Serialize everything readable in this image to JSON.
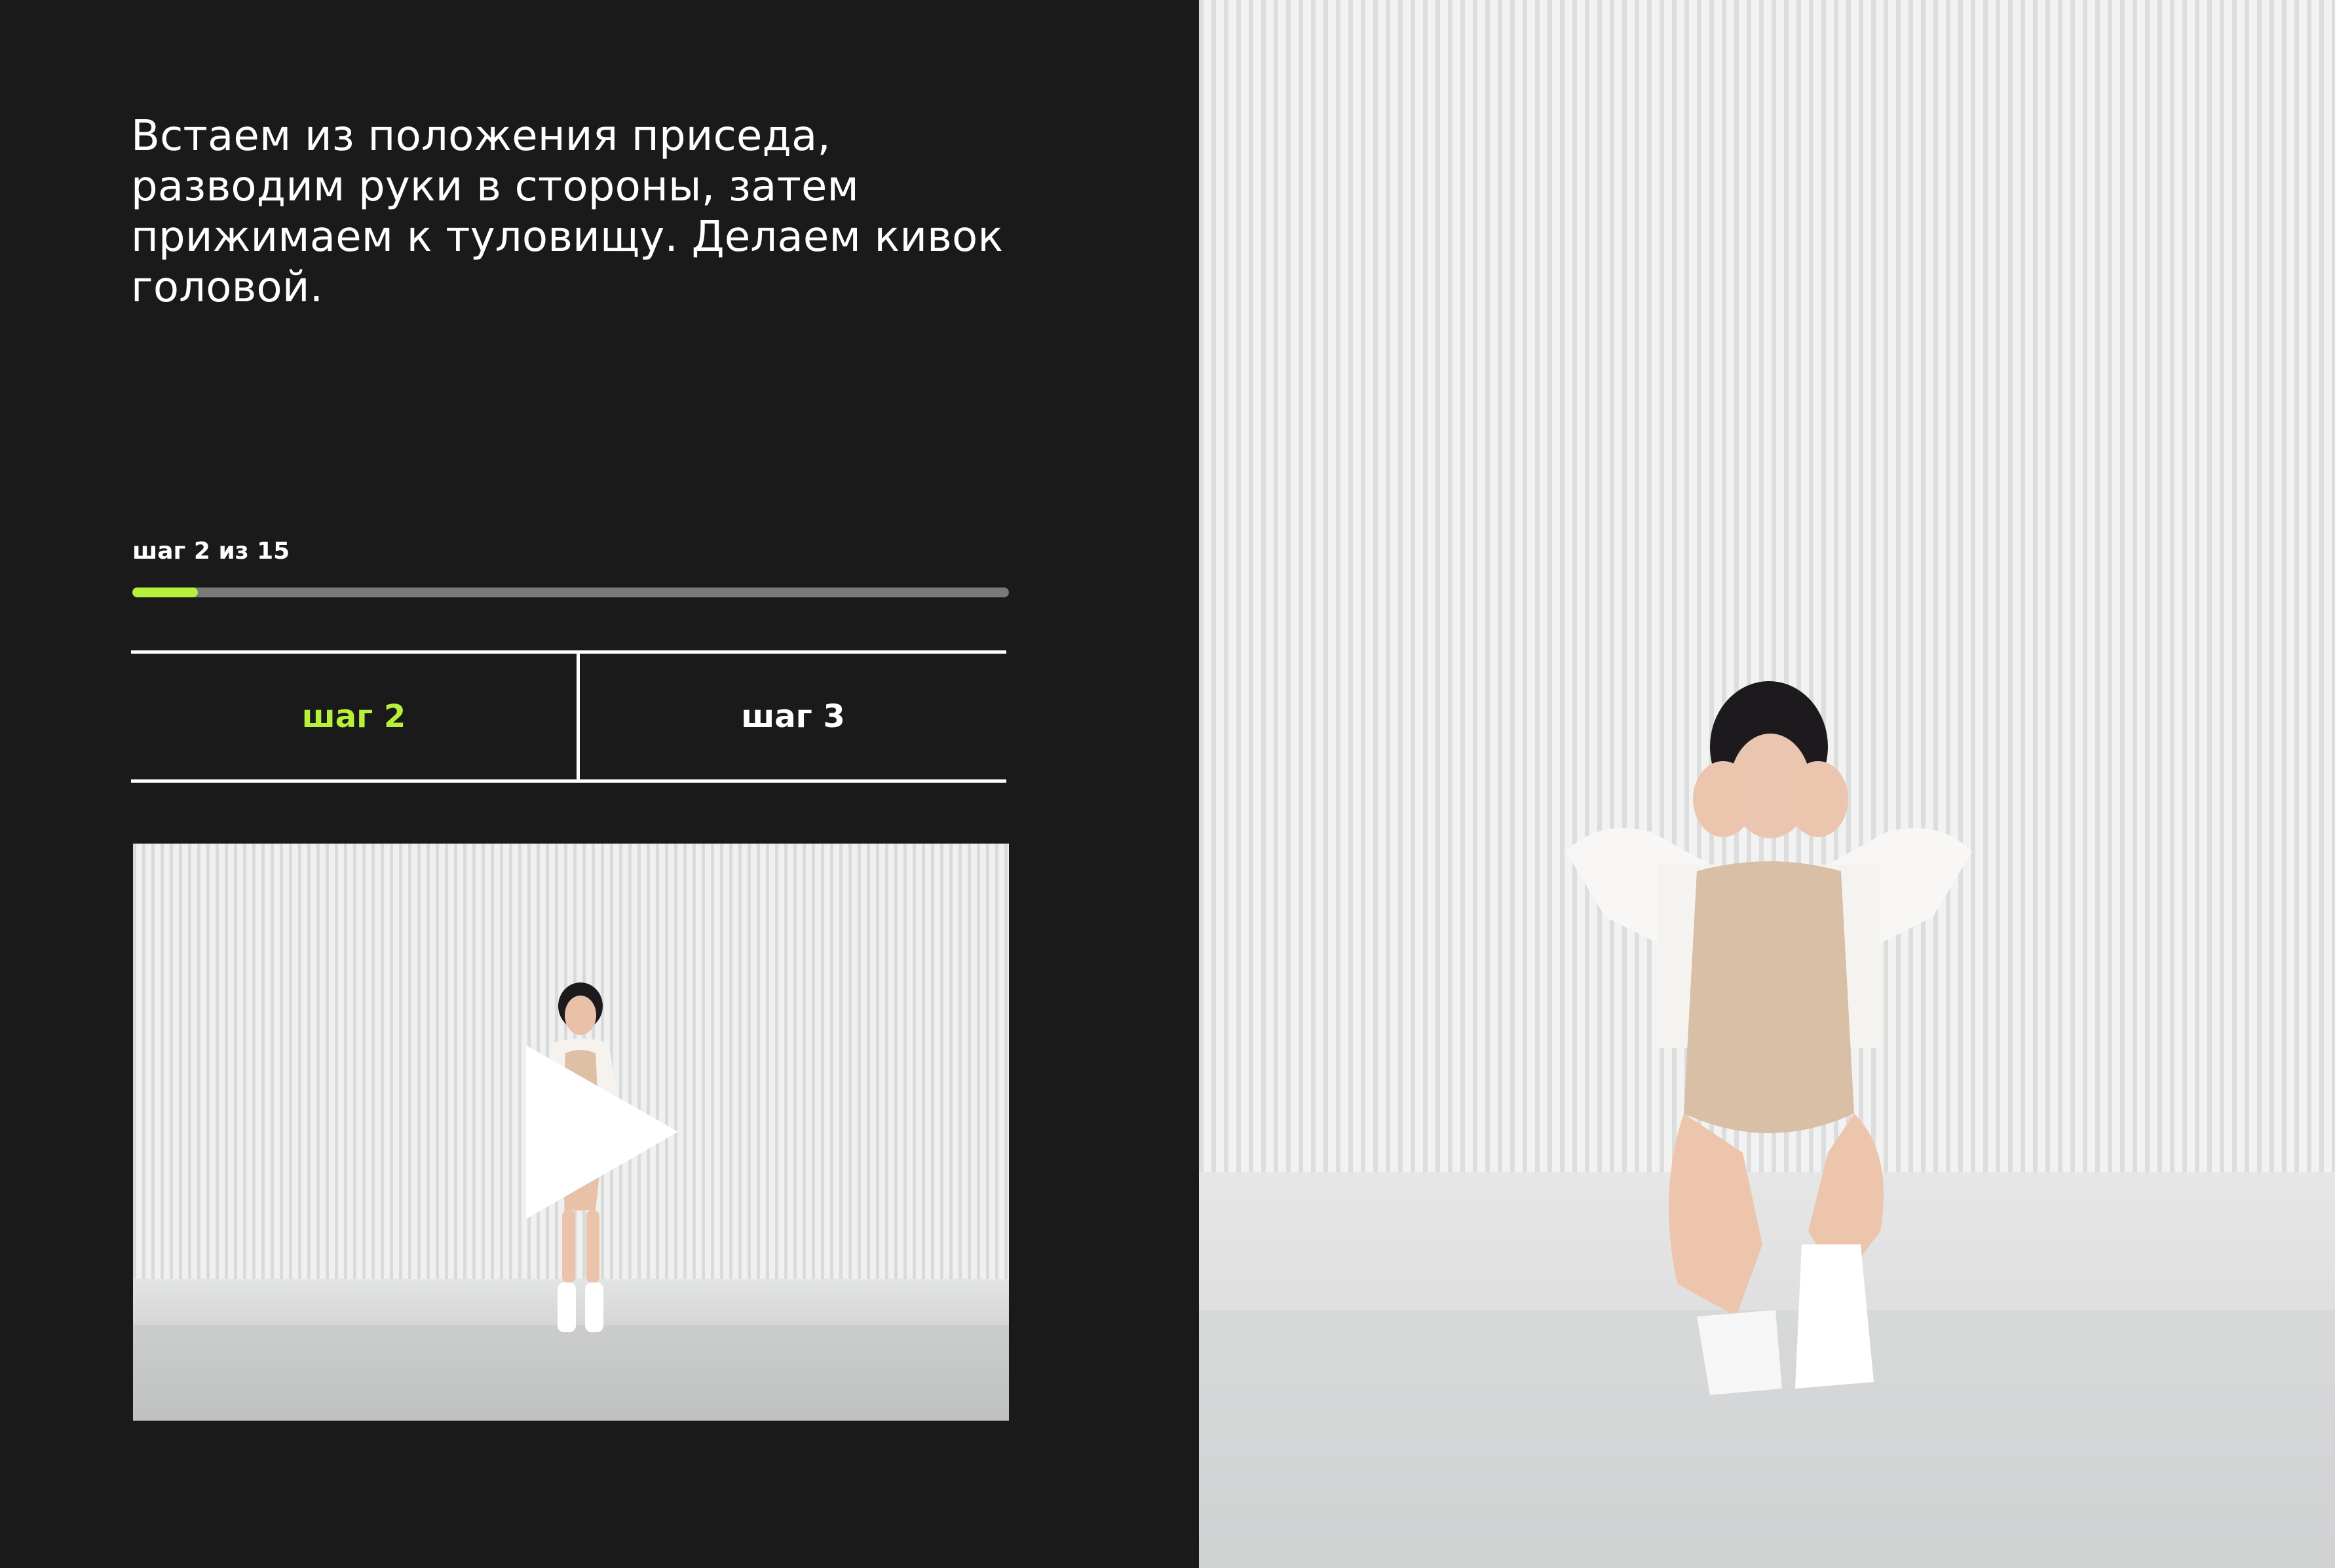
{
  "lesson": {
    "instruction": "Встаем из положения приседа, разводим руки в стороны, затем прижимаем к туловищу. Делаем кивок головой.",
    "progress": {
      "label": "шаг 2 из 15",
      "current": 2,
      "total": 15,
      "fraction": 0.075
    },
    "tabs": [
      {
        "label": "шаг 2",
        "state": "current"
      },
      {
        "label": "шаг 3",
        "state": "next"
      }
    ],
    "preview": {
      "icon": "play-icon"
    },
    "main_video": {
      "icon": "none"
    }
  },
  "colors": {
    "background": "#1a1a1b",
    "accent": "#b7f03a",
    "text": "#ffffff",
    "track": "#7a7a7a"
  }
}
